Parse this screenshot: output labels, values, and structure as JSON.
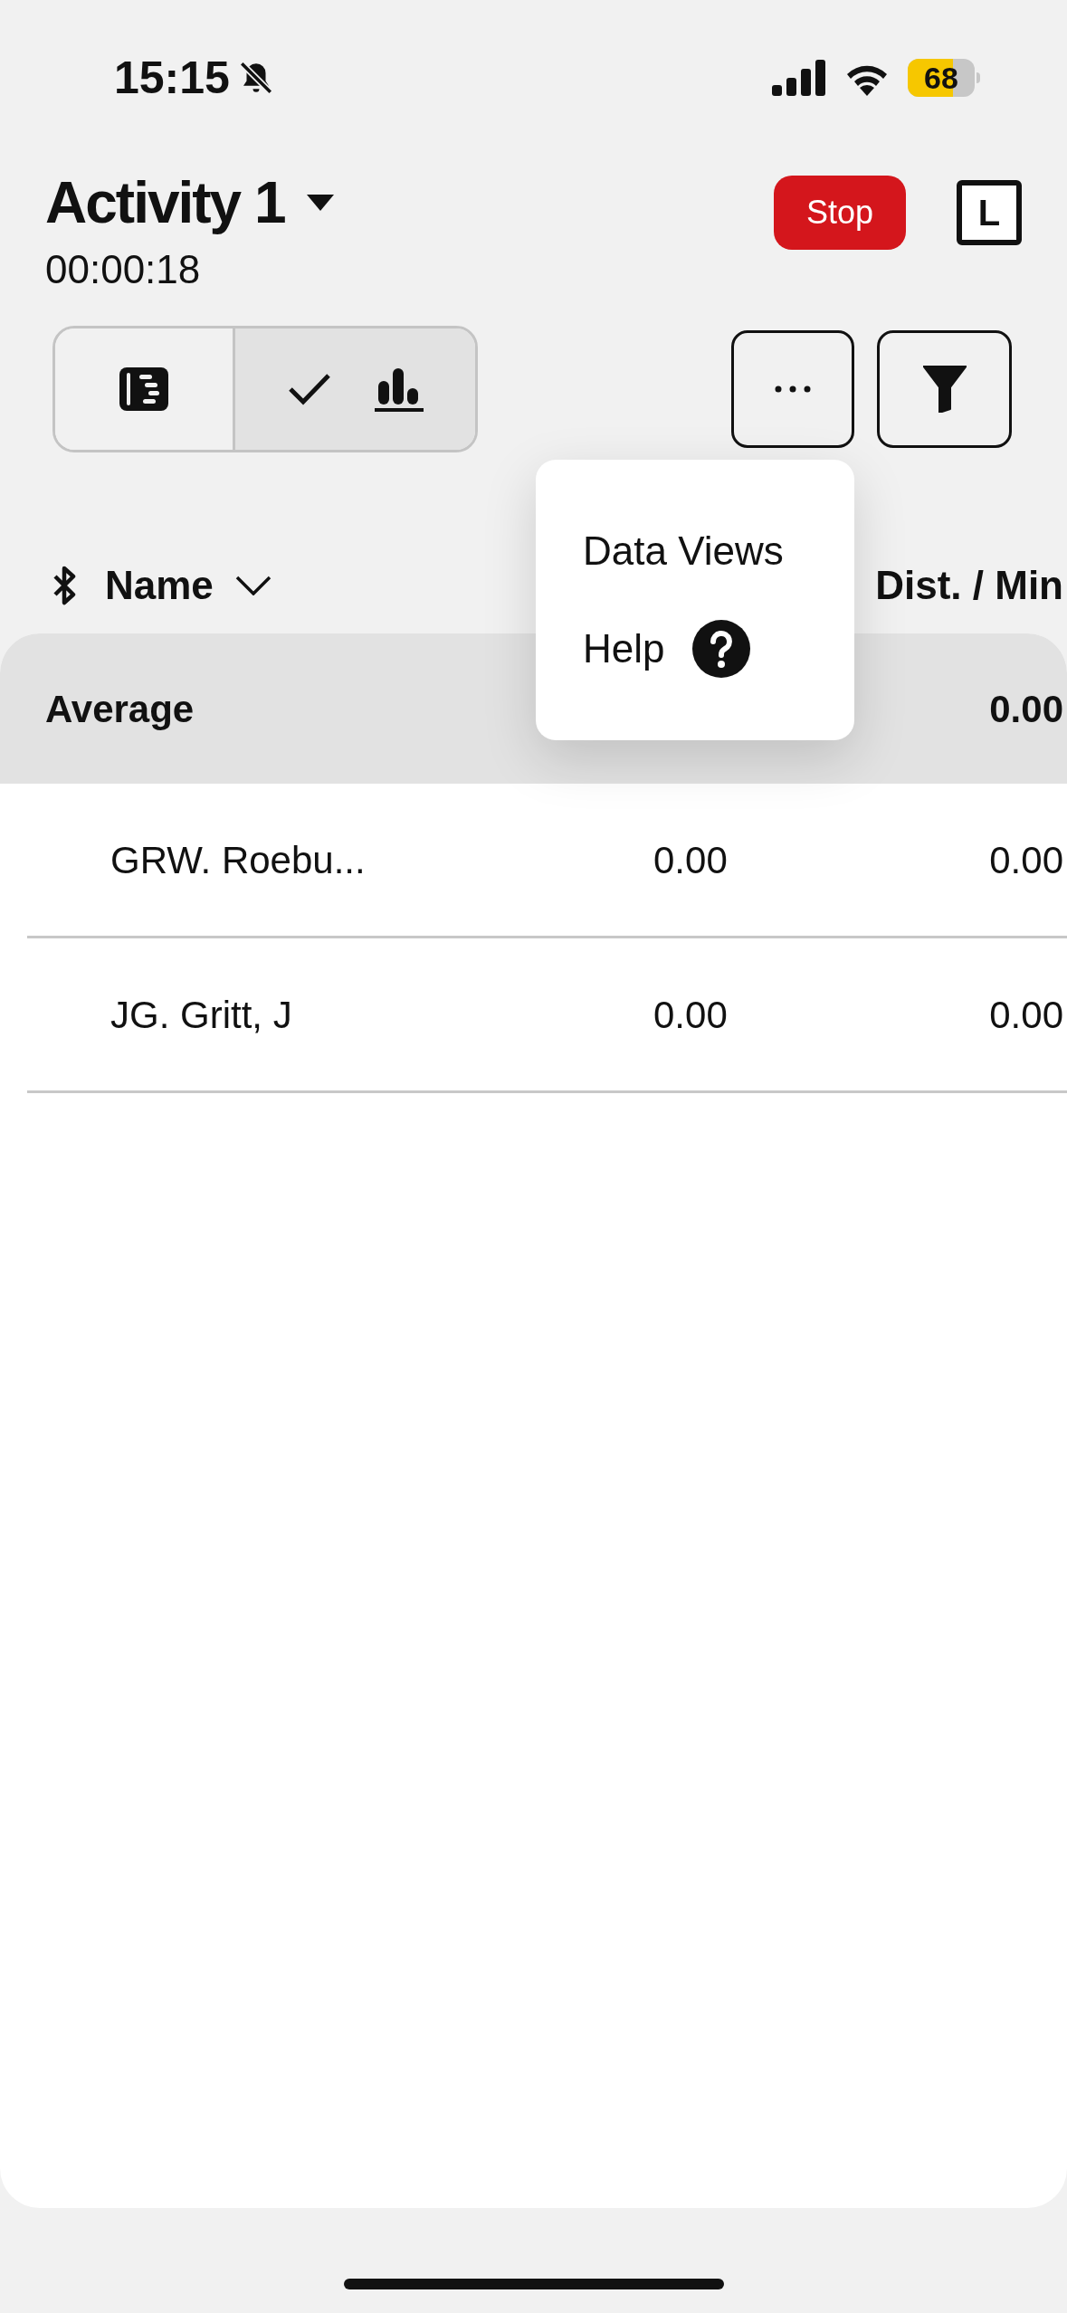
{
  "status_bar": {
    "time": "15:15",
    "silent": true,
    "battery": "68"
  },
  "header": {
    "title": "Activity 1",
    "timer": "00:00:18",
    "stop_button": "Stop",
    "badge": "L"
  },
  "view_toggle": [
    {
      "kind": "list",
      "selected": false
    },
    {
      "kind": "chart",
      "selected": true
    }
  ],
  "menu": {
    "items": [
      {
        "label": "Data Views",
        "kind": "plain"
      },
      {
        "label": "Help",
        "kind": "help"
      }
    ]
  },
  "table": {
    "columns": [
      {
        "label": "Name",
        "kind": "name"
      },
      {
        "label": "Dist. / Min",
        "kind": "value"
      }
    ],
    "average": {
      "label": "Average",
      "value": "0.00"
    },
    "rows": [
      {
        "name": "GRW. Roebu...",
        "column_2": "0.00",
        "column_3": "0.00"
      },
      {
        "name": "JG. Gritt, J",
        "column_2": "0.00",
        "column_3": "0.00"
      }
    ]
  }
}
